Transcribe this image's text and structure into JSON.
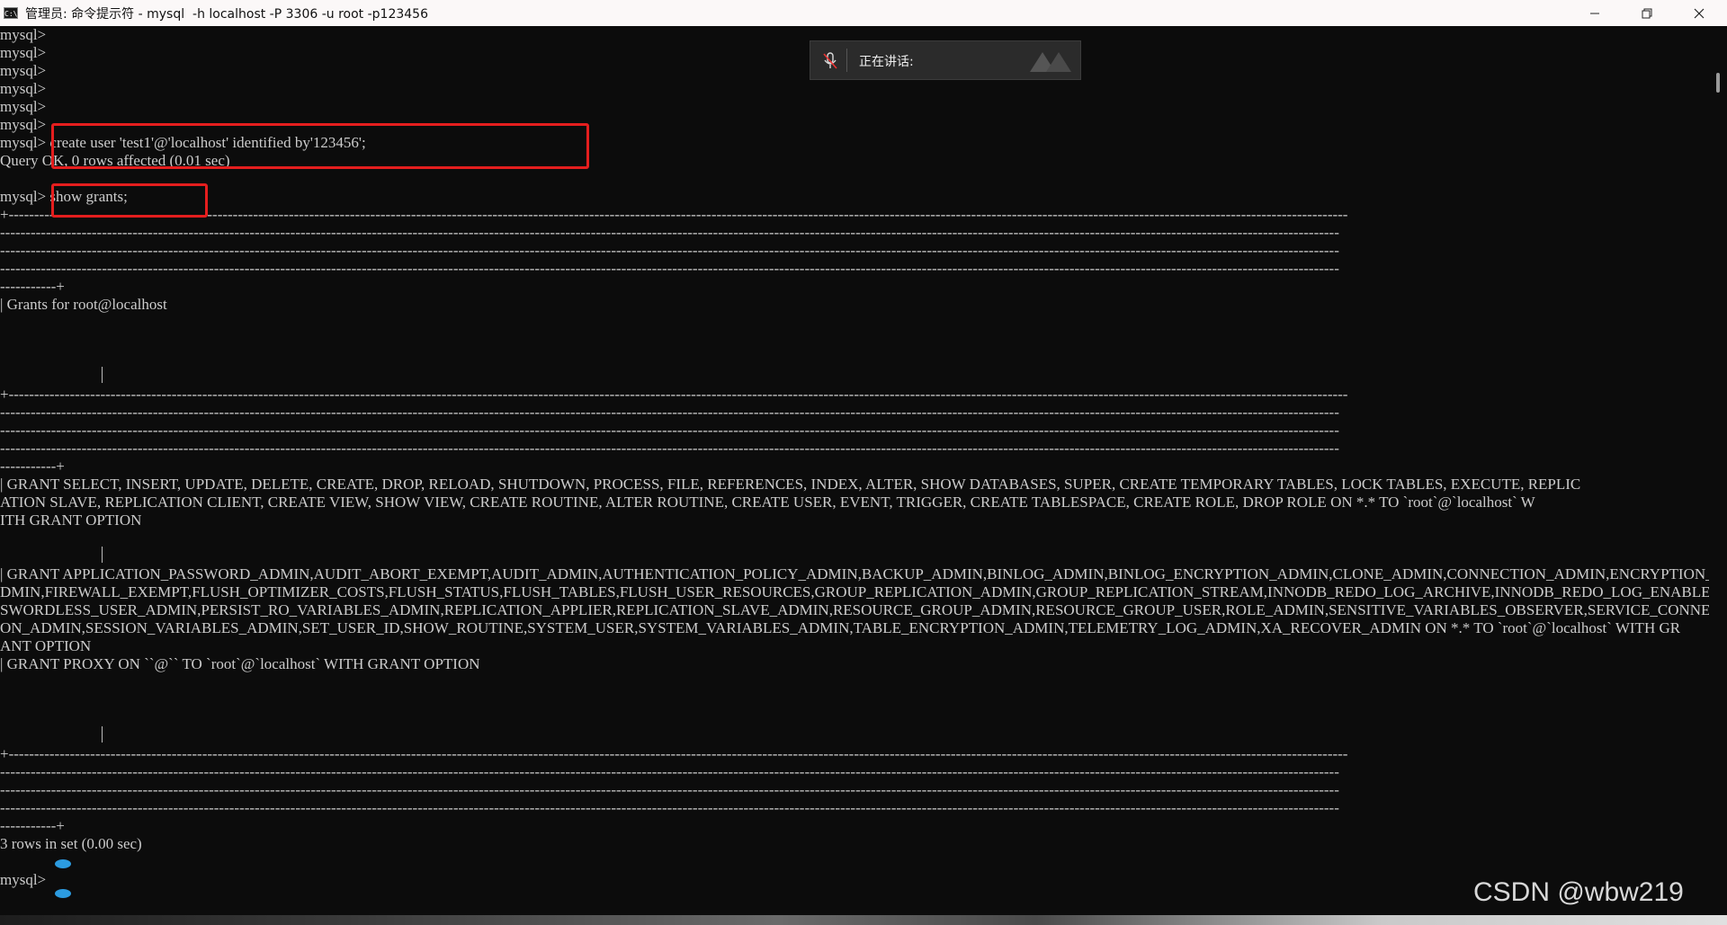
{
  "window": {
    "title": "管理员: 命令提示符 - mysql  -h localhost -P 3306 -u root -p123456",
    "icon_text": "C:\\",
    "minimize_icon": "minimize-icon",
    "maximize_icon": "restore-icon",
    "close_icon": "close-icon"
  },
  "speaking_popup": {
    "label": "正在讲话:",
    "icon": "mic-muted-icon"
  },
  "terminal": {
    "lines": [
      "mysql>",
      "mysql>",
      "mysql>",
      "mysql>",
      "mysql>",
      "mysql>",
      "mysql> create user 'test1'@'localhost' identified by'123456';",
      "Query OK, 0 rows affected (0.01 sec)",
      "",
      "mysql> show grants;",
      "+-----------------------------------------------------------------------------------------------------------------------------------------------------------------------------------------------------------------------------------------------------------------------",
      "-----------------------------------------------------------------------------------------------------------------------------------------------------------------------------------------------------------------------------------------------------------------------",
      "-----------------------------------------------------------------------------------------------------------------------------------------------------------------------------------------------------------------------------------------------------------------------",
      "-----------------------------------------------------------------------------------------------------------------------------------------------------------------------------------------------------------------------------------------------------------------------",
      "-----------+",
      "| Grants for root@localhost",
      "",
      "",
      "",
      "",
      "+-----------------------------------------------------------------------------------------------------------------------------------------------------------------------------------------------------------------------------------------------------------------------",
      "-----------------------------------------------------------------------------------------------------------------------------------------------------------------------------------------------------------------------------------------------------------------------",
      "-----------------------------------------------------------------------------------------------------------------------------------------------------------------------------------------------------------------------------------------------------------------------",
      "-----------------------------------------------------------------------------------------------------------------------------------------------------------------------------------------------------------------------------------------------------------------------",
      "-----------+",
      "| GRANT SELECT, INSERT, UPDATE, DELETE, CREATE, DROP, RELOAD, SHUTDOWN, PROCESS, FILE, REFERENCES, INDEX, ALTER, SHOW DATABASES, SUPER, CREATE TEMPORARY TABLES, LOCK TABLES, EXECUTE, REPLIC",
      "ATION SLAVE, REPLICATION CLIENT, CREATE VIEW, SHOW VIEW, CREATE ROUTINE, ALTER ROUTINE, CREATE USER, EVENT, TRIGGER, CREATE TABLESPACE, CREATE ROLE, DROP ROLE ON *.* TO `root`@`localhost` W",
      "ITH GRANT OPTION",
      "",
      "",
      "| GRANT APPLICATION_PASSWORD_ADMIN,AUDIT_ABORT_EXEMPT,AUDIT_ADMIN,AUTHENTICATION_POLICY_ADMIN,BACKUP_ADMIN,BINLOG_ADMIN,BINLOG_ENCRYPTION_ADMIN,CLONE_ADMIN,CONNECTION_ADMIN,ENCRYPTION_KEY_A",
      "DMIN,FIREWALL_EXEMPT,FLUSH_OPTIMIZER_COSTS,FLUSH_STATUS,FLUSH_TABLES,FLUSH_USER_RESOURCES,GROUP_REPLICATION_ADMIN,GROUP_REPLICATION_STREAM,INNODB_REDO_LOG_ARCHIVE,INNODB_REDO_LOG_ENABLE,PAS",
      "SWORDLESS_USER_ADMIN,PERSIST_RO_VARIABLES_ADMIN,REPLICATION_APPLIER,REPLICATION_SLAVE_ADMIN,RESOURCE_GROUP_ADMIN,RESOURCE_GROUP_USER,ROLE_ADMIN,SENSITIVE_VARIABLES_OBSERVER,SERVICE_CONNECTI",
      "ON_ADMIN,SESSION_VARIABLES_ADMIN,SET_USER_ID,SHOW_ROUTINE,SYSTEM_USER,SYSTEM_VARIABLES_ADMIN,TABLE_ENCRYPTION_ADMIN,TELEMETRY_LOG_ADMIN,XA_RECOVER_ADMIN ON *.* TO `root`@`localhost` WITH GR",
      "ANT OPTION",
      "| GRANT PROXY ON ``@`` TO `root`@`localhost` WITH GRANT OPTION",
      "",
      "",
      "",
      "",
      "+-----------------------------------------------------------------------------------------------------------------------------------------------------------------------------------------------------------------------------------------------------------------------",
      "-----------------------------------------------------------------------------------------------------------------------------------------------------------------------------------------------------------------------------------------------------------------------",
      "-----------------------------------------------------------------------------------------------------------------------------------------------------------------------------------------------------------------------------------------------------------------------",
      "-----------------------------------------------------------------------------------------------------------------------------------------------------------------------------------------------------------------------------------------------------------------------",
      "-----------+",
      "3 rows in set (0.00 sec)",
      "",
      "mysql>"
    ]
  },
  "watermark": "CSDN @wbw219",
  "colors": {
    "terminal_bg": "#0c0c0c",
    "terminal_fg": "#cccccc",
    "highlight": "#e51e1e",
    "titlebar_bg": "#fbf8f8"
  }
}
